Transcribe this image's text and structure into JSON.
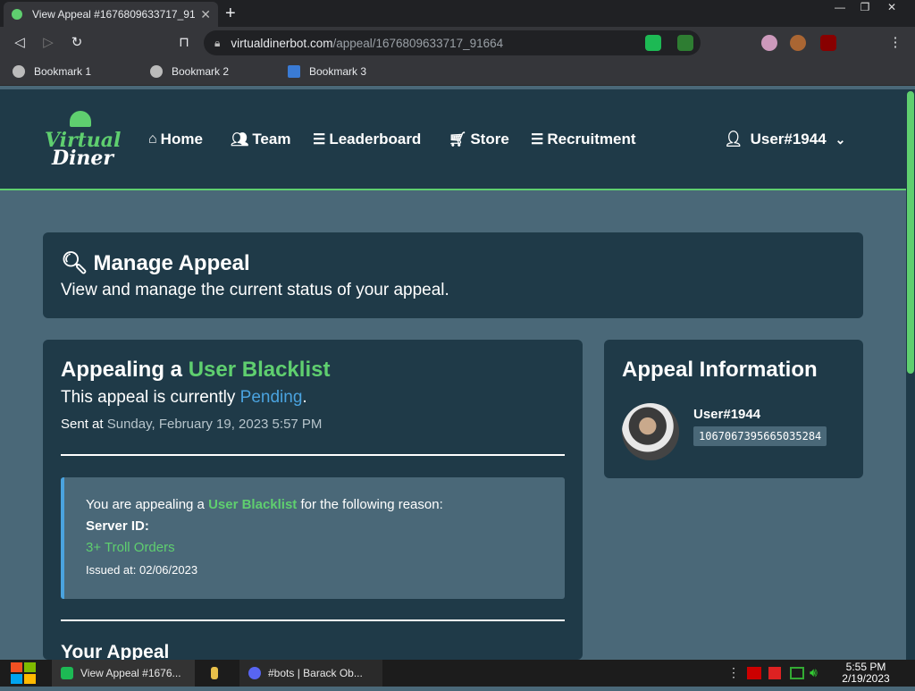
{
  "browser": {
    "tab_title": "View Appeal #1676809633717_91",
    "tab_close": "✕",
    "new_tab": "+",
    "url_domain": "virtualdinerbot.com",
    "url_path": "/appeal/1676809633717_91664",
    "bookmarks": [
      "Bookmark 1",
      "Bookmark 2",
      "Bookmark 3"
    ]
  },
  "site": {
    "logo_line1": "Virtual",
    "logo_line2": "Diner",
    "nav": [
      "Home",
      "Team",
      "Leaderboard",
      "Store",
      "Recruitment"
    ],
    "username": "User#1944"
  },
  "manage": {
    "title": "Manage Appeal",
    "subtitle": "View and manage the current status of your appeal."
  },
  "appeal": {
    "heading_prefix": "Appealing a",
    "heading_type": "User Blacklist",
    "status_prefix": "This appeal is currently",
    "status": "Pending",
    "status_suffix": ".",
    "sent_label": "Sent at",
    "sent_at": "Sunday, February 19, 2023 5:57 PM",
    "reason_prefix": "You are appealing a",
    "reason_type": "User Blacklist",
    "reason_suffix": "for the following reason:",
    "server_label": "Server ID:",
    "reason": "3+ Troll Orders",
    "issued": "Issued at: 02/06/2023",
    "your_appeal": "Your Appeal"
  },
  "info": {
    "title": "Appeal Information",
    "user": "User#1944",
    "user_id": "1067067395665035284"
  },
  "taskbar": {
    "app1": "View Appeal #1676...",
    "app2": "#bots | Barack Ob...",
    "time": "5:55 PM",
    "date": "2/19/2023"
  },
  "colors": {
    "accent": "#5fcf6f",
    "link": "#4aa3df",
    "card": "#1f3a48",
    "page": "#4a6878"
  }
}
